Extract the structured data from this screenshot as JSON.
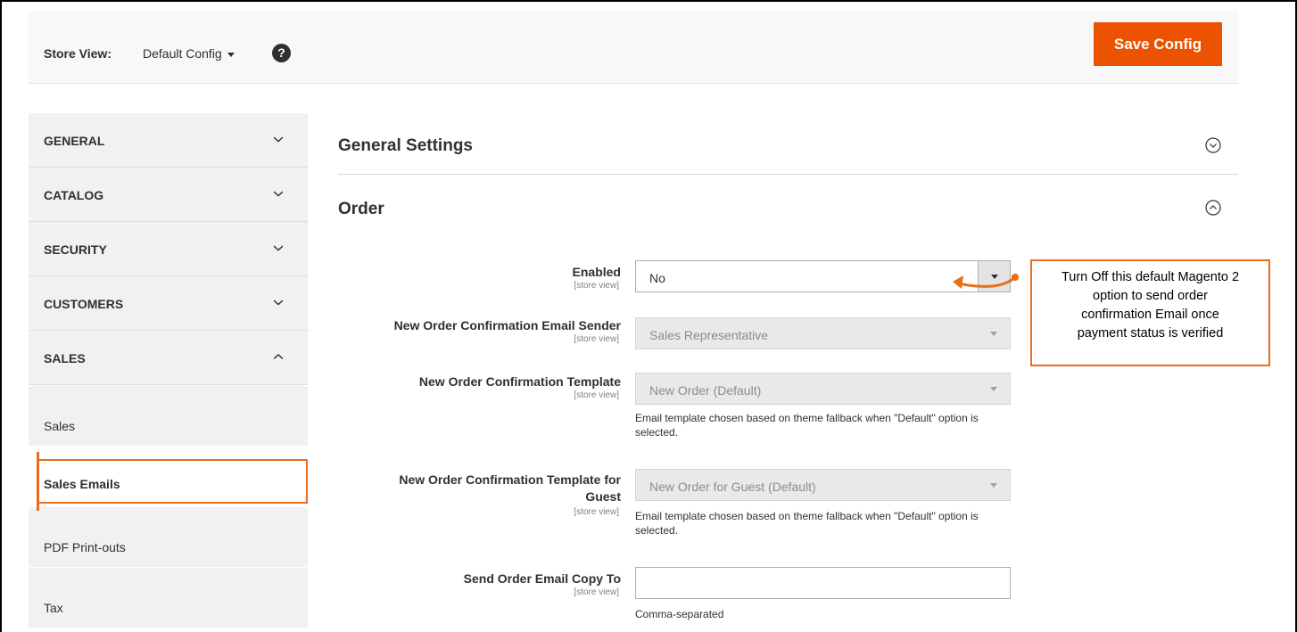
{
  "topbar": {
    "store_view_label": "Store View:",
    "store_view_value": "Default Config",
    "help_glyph": "?",
    "save_label": "Save Config"
  },
  "sidebar": {
    "groups": [
      {
        "label": "GENERAL",
        "expanded": false
      },
      {
        "label": "CATALOG",
        "expanded": false
      },
      {
        "label": "SECURITY",
        "expanded": false
      },
      {
        "label": "CUSTOMERS",
        "expanded": false
      },
      {
        "label": "SALES",
        "expanded": true
      }
    ],
    "items": [
      {
        "label": "Sales",
        "active": false
      },
      {
        "label": "Sales Emails",
        "active": true
      },
      {
        "label": "PDF Print-outs",
        "active": false
      },
      {
        "label": "Tax",
        "active": false
      }
    ]
  },
  "main": {
    "sections": [
      {
        "title": "General Settings",
        "icon": "chevron-down-circle-icon"
      },
      {
        "title": "Order",
        "icon": "chevron-up-circle-icon"
      }
    ],
    "fields": [
      {
        "label": "Enabled",
        "scope": "[store view]",
        "value": "No",
        "disabled": false
      },
      {
        "label": "New Order Confirmation Email Sender",
        "scope": "[store view]",
        "value": "Sales Representative",
        "disabled": true
      },
      {
        "label": "New Order Confirmation Template",
        "scope": "[store view]",
        "value": "New Order (Default)",
        "disabled": true,
        "note": "Email template chosen based on theme fallback when \"Default\" option is selected."
      },
      {
        "label_line1": "New Order Confirmation Template for",
        "label_line2": "Guest",
        "scope": "[store view]",
        "value": "New Order for Guest (Default)",
        "disabled": true,
        "note": "Email template chosen based on theme fallback when \"Default\" option is selected."
      },
      {
        "label": "Send Order Email Copy To",
        "scope": "[store view]",
        "value": "",
        "note": "Comma-separated"
      }
    ]
  },
  "callout": {
    "line1": "Turn Off this default Magento 2",
    "line2": "option to send order",
    "line3": "confirmation Email once",
    "line4": "payment status is verified"
  },
  "colors": {
    "accent": "#eb5202",
    "highlight": "#eb6d1c"
  }
}
